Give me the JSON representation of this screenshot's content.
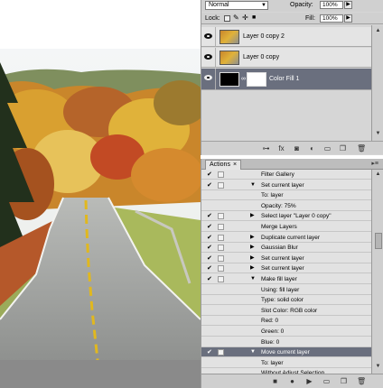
{
  "layers_panel": {
    "blend_mode": "Normal",
    "opacity_label": "Opacity:",
    "opacity_value": "100%",
    "lock_label": "Lock:",
    "fill_label": "Fill:",
    "fill_value": "100%",
    "layers": [
      {
        "name": "Layer 0 copy 2",
        "selected": false
      },
      {
        "name": "Layer 0 copy",
        "selected": false
      },
      {
        "name": "Color Fill 1",
        "selected": true
      }
    ]
  },
  "actions_panel": {
    "tab_label": "Actions",
    "close_glyph": "×",
    "rows": [
      {
        "text": "Filter Gallery",
        "checked": true,
        "expandable": false,
        "indent": false,
        "selected": false
      },
      {
        "text": "Set current layer",
        "checked": true,
        "expandable": true,
        "expanded": true,
        "indent": false,
        "selected": false
      },
      {
        "text": "To: layer",
        "checked": false,
        "indent": true,
        "selected": false
      },
      {
        "text": "Opacity: 75%",
        "checked": false,
        "indent": true,
        "selected": false
      },
      {
        "text": "Select layer \"Layer 0 copy\"",
        "checked": true,
        "expandable": true,
        "expanded": false,
        "indent": false,
        "selected": false
      },
      {
        "text": "Merge Layers",
        "checked": true,
        "expandable": false,
        "indent": false,
        "selected": false
      },
      {
        "text": "Duplicate current layer",
        "checked": true,
        "expandable": true,
        "expanded": false,
        "indent": false,
        "selected": false
      },
      {
        "text": "Gaussian Blur",
        "checked": true,
        "expandable": true,
        "expanded": false,
        "indent": false,
        "selected": false
      },
      {
        "text": "Set current layer",
        "checked": true,
        "expandable": true,
        "expanded": false,
        "indent": false,
        "selected": false
      },
      {
        "text": "Set current layer",
        "checked": true,
        "expandable": true,
        "expanded": false,
        "indent": false,
        "selected": false
      },
      {
        "text": "Make fill layer",
        "checked": true,
        "expandable": true,
        "expanded": true,
        "indent": false,
        "selected": false
      },
      {
        "text": "Using: fill layer",
        "checked": false,
        "indent": true,
        "selected": false
      },
      {
        "text": "Type: solid color",
        "checked": false,
        "indent": true,
        "selected": false
      },
      {
        "text": "Slot Color: RGB color",
        "checked": false,
        "indent": true,
        "selected": false
      },
      {
        "text": "Red: 0",
        "checked": false,
        "indent": true,
        "selected": false
      },
      {
        "text": "Green: 0",
        "checked": false,
        "indent": true,
        "selected": false
      },
      {
        "text": "Blue: 0",
        "checked": false,
        "indent": true,
        "selected": false
      },
      {
        "text": "Move current layer",
        "checked": true,
        "expandable": true,
        "expanded": true,
        "indent": false,
        "selected": true
      },
      {
        "text": "To: layer",
        "checked": false,
        "indent": true,
        "selected": false
      },
      {
        "text": "Without Adjust Selection",
        "checked": false,
        "indent": true,
        "selected": false
      }
    ]
  },
  "colors": {
    "selection": "#6a6f7e",
    "panel_bg": "#d6d6d6",
    "canvas_gray": "#8a8a8a"
  }
}
